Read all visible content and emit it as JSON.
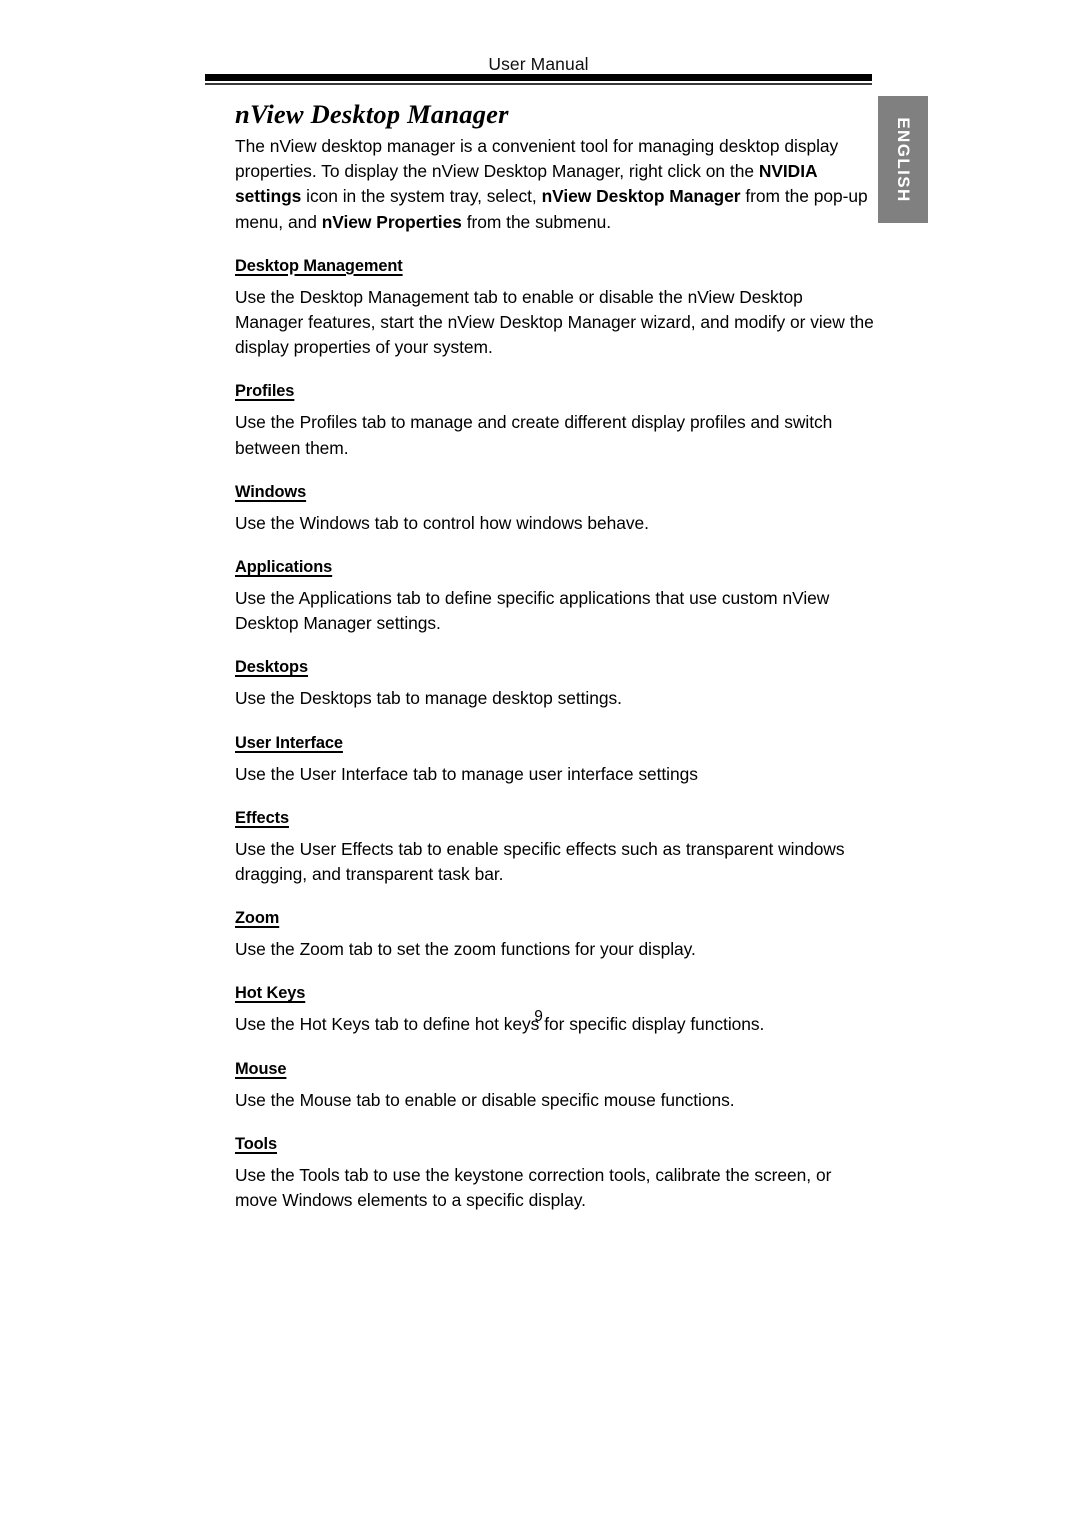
{
  "header": {
    "running_title": "User Manual"
  },
  "side_tab": {
    "label": "ENGLISH",
    "background_color": "#808080",
    "text_color": "#ffffff"
  },
  "document": {
    "title": "nView Desktop Manager",
    "intro": {
      "part1": "The nView desktop manager is a convenient tool for managing desktop display properties. To display the nView Desktop Manager, right click on the ",
      "bold1": "NVIDIA settings",
      "part2": " icon in the system tray, select, ",
      "bold2": "nView Desktop Manager",
      "part3": " from the pop-up menu, and ",
      "bold3": "nView Properties",
      "part4": " from the submenu."
    },
    "sections": [
      {
        "heading": "Desktop Management",
        "body": "Use the Desktop Management tab to enable or disable the nView Desktop Manager features, start the nView Desktop Manager wizard, and modify or view the display properties of your system."
      },
      {
        "heading": "Profiles",
        "body": "Use the Profiles tab to manage and create different display profiles and switch between them."
      },
      {
        "heading": "Windows",
        "body": "Use the Windows tab to control how windows behave."
      },
      {
        "heading": "Applications",
        "body": "Use the Applications tab to define specific applications that use custom nView Desktop Manager settings."
      },
      {
        "heading": "Desktops",
        "body": "Use the Desktops tab to manage desktop settings."
      },
      {
        "heading": "User Interface",
        "body": "Use the User Interface tab to manage user interface settings"
      },
      {
        "heading": "Effects",
        "body": "Use the User Effects tab to enable specific effects such as transparent windows dragging, and transparent task bar."
      },
      {
        "heading": "Zoom",
        "body": "Use the Zoom tab to set the zoom functions for your display."
      },
      {
        "heading": "Hot Keys",
        "body": "Use the Hot Keys tab to define hot keys for specific display functions."
      },
      {
        "heading": "Mouse",
        "body": "Use the Mouse tab to enable or disable specific mouse functions."
      },
      {
        "heading": "Tools",
        "body": "Use the Tools tab to use the keystone correction tools, calibrate the screen, or move Windows elements to a specific display."
      }
    ]
  },
  "footer": {
    "page_number": "9"
  }
}
